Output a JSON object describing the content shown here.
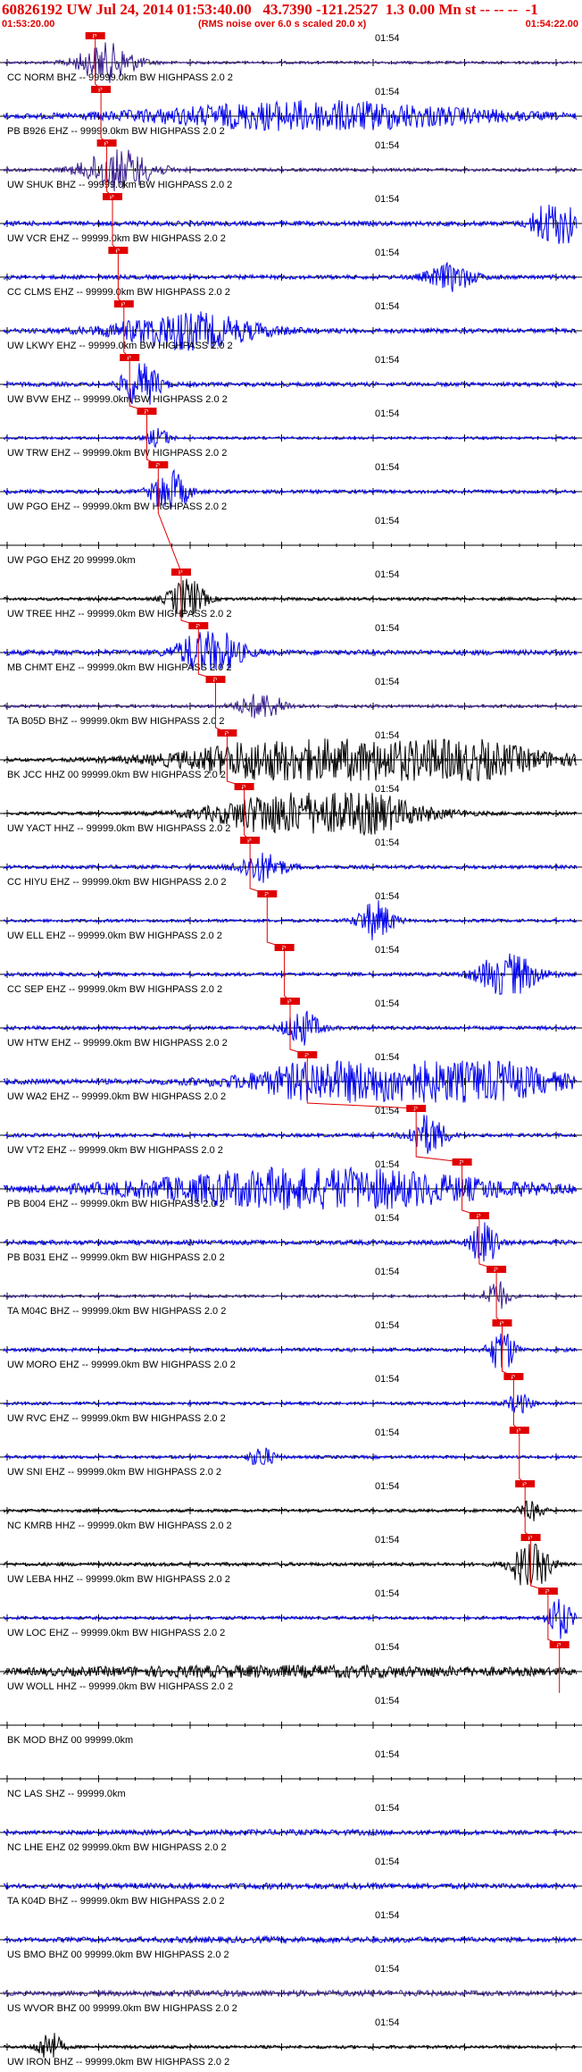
{
  "header": {
    "title": "60826192 UW Jul 24, 2014 01:53:40.00   43.7390 -121.2527  1.3 0.00 Mn st -- -- --  -1",
    "start_time": "01:53:20.00",
    "end_time": "01:54:22.00",
    "note": "(RMS noise over 6.0 s scaled 20.0 x)"
  },
  "time_tick_label": "01:54",
  "pick_label": "P",
  "colors": {
    "title": "#e00000",
    "trace_blue": "#0000ee",
    "trace_black": "#000000",
    "trace_purple": "#3a1f8f",
    "pick": "#e00000"
  },
  "stations": [
    {
      "label": "CC NORM BHZ -- 99999.0km BW  HIGHPASS  2.0  2",
      "color": "#3a1f8f",
      "amp": 0.25,
      "pick": 0.16,
      "burst": {
        "at": 0.18,
        "w": 0.05,
        "a": 1.2
      }
    },
    {
      "label": "PB B926 EHZ -- 99999.0km BW  HIGHPASS  2.0  2",
      "color": "#0000ee",
      "amp": 0.35,
      "pick": 0.17,
      "burst": {
        "at": 0.55,
        "w": 0.3,
        "a": 0.9
      }
    },
    {
      "label": "UW SHUK BHZ -- 99999.0km BW  HIGHPASS  2.0  2",
      "color": "#3a1f8f",
      "amp": 0.3,
      "pick": 0.18,
      "burst": {
        "at": 0.2,
        "w": 0.06,
        "a": 1.3
      }
    },
    {
      "label": "UW VCR EHZ -- 99999.0km BW  HIGHPASS  2.0  2",
      "color": "#0000ee",
      "amp": 0.45,
      "pick": 0.19,
      "burst": {
        "at": 0.96,
        "w": 0.03,
        "a": 2.4
      }
    },
    {
      "label": "CC CLMS EHZ -- 99999.0km BW  HIGHPASS  2.0  2",
      "color": "#0000ee",
      "amp": 0.4,
      "pick": 0.2,
      "burst": {
        "at": 0.78,
        "w": 0.04,
        "a": 0.8
      }
    },
    {
      "label": "UW LKWY EHZ -- 99999.0km BW  HIGHPASS  2.0  2",
      "color": "#0000ee",
      "amp": 0.45,
      "pick": 0.21,
      "burst": {
        "at": 0.32,
        "w": 0.12,
        "a": 1.1
      }
    },
    {
      "label": "UW BVW EHZ -- 99999.0km BW  HIGHPASS  2.0  2",
      "color": "#0000ee",
      "amp": 0.4,
      "pick": 0.22,
      "burst": {
        "at": 0.24,
        "w": 0.03,
        "a": 1.6
      }
    },
    {
      "label": "UW TRW EHZ -- 99999.0km BW  HIGHPASS  2.0  2",
      "color": "#0000ee",
      "amp": 0.25,
      "pick": 0.25,
      "burst": {
        "at": 0.27,
        "w": 0.02,
        "a": 0.6
      }
    },
    {
      "label": "UW PGO EHZ -- 99999.0km BW  HIGHPASS  2.0  2",
      "color": "#0000ee",
      "amp": 0.35,
      "pick": 0.27,
      "burst": {
        "at": 0.29,
        "w": 0.03,
        "a": 1.4
      }
    },
    {
      "label": "UW PGO EHZ 20 99999.0km",
      "color": "#0000ee",
      "amp": 0.0,
      "pick": 0.0,
      "burst": {
        "at": 0.0,
        "w": 0.01,
        "a": 0.0
      }
    },
    {
      "label": "UW TREE HHZ -- 99999.0km BW  HIGHPASS  2.0  2",
      "color": "#000000",
      "amp": 0.3,
      "pick": 0.31,
      "burst": {
        "at": 0.32,
        "w": 0.03,
        "a": 1.3
      }
    },
    {
      "label": "MB CHMT EHZ -- 99999.0km BW  HIGHPASS  2.0  2",
      "color": "#0000ee",
      "amp": 0.5,
      "pick": 0.34,
      "burst": {
        "at": 0.36,
        "w": 0.05,
        "a": 1.6
      }
    },
    {
      "label": "TA B05D BHZ -- 99999.0km BW  HIGHPASS  2.0  2",
      "color": "#3a1f8f",
      "amp": 0.3,
      "pick": 0.37,
      "burst": {
        "at": 0.45,
        "w": 0.04,
        "a": 0.8
      }
    },
    {
      "label": "BK JCC HHZ 00 99999.0km BW  HIGHPASS  2.0  2",
      "color": "#000000",
      "amp": 0.3,
      "pick": 0.39,
      "burst": {
        "at": 0.63,
        "w": 0.25,
        "a": 2.4
      }
    },
    {
      "label": "UW YACT HHZ -- 99999.0km BW  HIGHPASS  2.0  2",
      "color": "#000000",
      "amp": 0.3,
      "pick": 0.42,
      "burst": {
        "at": 0.55,
        "w": 0.15,
        "a": 2.0
      }
    },
    {
      "label": "CC HIYU EHZ -- 99999.0km BW  HIGHPASS  2.0  2",
      "color": "#0000ee",
      "amp": 0.35,
      "pick": 0.43,
      "burst": {
        "at": 0.45,
        "w": 0.04,
        "a": 0.9
      }
    },
    {
      "label": "UW ELL EHZ -- 99999.0km BW  HIGHPASS  2.0  2",
      "color": "#0000ee",
      "amp": 0.3,
      "pick": 0.46,
      "burst": {
        "at": 0.65,
        "w": 0.03,
        "a": 1.2
      }
    },
    {
      "label": "CC SEP EHZ -- 99999.0km BW  HIGHPASS  2.0  2",
      "color": "#0000ee",
      "amp": 0.35,
      "pick": 0.49,
      "burst": {
        "at": 0.88,
        "w": 0.05,
        "a": 1.4
      }
    },
    {
      "label": "UW HTW EHZ -- 99999.0km BW  HIGHPASS  2.0  2",
      "color": "#0000ee",
      "amp": 0.35,
      "pick": 0.5,
      "burst": {
        "at": 0.52,
        "w": 0.03,
        "a": 1.1
      }
    },
    {
      "label": "UW WA2 EHZ -- 99999.0km BW  HIGHPASS  2.0  2",
      "color": "#0000ee",
      "amp": 0.5,
      "pick": 0.53,
      "burst": {
        "at": 0.7,
        "w": 0.2,
        "a": 2.6
      }
    },
    {
      "label": "UW VT2 EHZ -- 99999.0km BW  HIGHPASS  2.0  2",
      "color": "#0000ee",
      "amp": 0.35,
      "pick": 0.72,
      "burst": {
        "at": 0.74,
        "w": 0.03,
        "a": 1.3
      }
    },
    {
      "label": "PB B004 EHZ -- 99999.0km BW  HIGHPASS  2.0  2",
      "color": "#0000ee",
      "amp": 0.5,
      "pick": 0.8,
      "burst": {
        "at": 0.55,
        "w": 0.3,
        "a": 1.3
      }
    },
    {
      "label": "PB B031 EHZ -- 99999.0km BW  HIGHPASS  2.0  2",
      "color": "#0000ee",
      "amp": 0.45,
      "pick": 0.83,
      "burst": {
        "at": 0.84,
        "w": 0.02,
        "a": 2.0
      }
    },
    {
      "label": "TA M04C BHZ -- 99999.0km BW  HIGHPASS  2.0  2",
      "color": "#3a1f8f",
      "amp": 0.25,
      "pick": 0.86,
      "burst": {
        "at": 0.86,
        "w": 0.02,
        "a": 1.0
      }
    },
    {
      "label": "UW MORO EHZ -- 99999.0km BW  HIGHPASS  2.0  2",
      "color": "#0000ee",
      "amp": 0.35,
      "pick": 0.87,
      "burst": {
        "at": 0.87,
        "w": 0.02,
        "a": 1.6
      }
    },
    {
      "label": "UW RVC EHZ -- 99999.0km BW  HIGHPASS  2.0  2",
      "color": "#0000ee",
      "amp": 0.3,
      "pick": 0.89,
      "burst": {
        "at": 0.9,
        "w": 0.02,
        "a": 0.6
      }
    },
    {
      "label": "UW SNI EHZ -- 99999.0km BW  HIGHPASS  2.0  2",
      "color": "#0000ee",
      "amp": 0.3,
      "pick": 0.9,
      "burst": {
        "at": 0.45,
        "w": 0.02,
        "a": 0.7
      }
    },
    {
      "label": "NC KMRB HHZ -- 99999.0km BW  HIGHPASS  2.0  2",
      "color": "#000000",
      "amp": 0.3,
      "pick": 0.91,
      "burst": {
        "at": 0.92,
        "w": 0.02,
        "a": 0.6
      }
    },
    {
      "label": "UW LEBA HHZ -- 99999.0km BW  HIGHPASS  2.0  2",
      "color": "#000000",
      "amp": 0.35,
      "pick": 0.92,
      "burst": {
        "at": 0.92,
        "w": 0.03,
        "a": 2.0
      }
    },
    {
      "label": "UW LOC EHZ -- 99999.0km BW  HIGHPASS  2.0  2",
      "color": "#0000ee",
      "amp": 0.3,
      "pick": 0.95,
      "burst": {
        "at": 0.97,
        "w": 0.02,
        "a": 1.4
      }
    },
    {
      "label": "UW WOLL HHZ -- 99999.0km BW  HIGHPASS  2.0  2",
      "color": "#000000",
      "amp": 0.35,
      "pick": 0.97,
      "burst": {
        "at": 0.5,
        "w": 0.5,
        "a": 0.3
      }
    },
    {
      "label": "BK MOD BHZ 00 99999.0km",
      "color": "#0000ee",
      "amp": 0.0,
      "pick": 0.0,
      "burst": {
        "at": 0.0,
        "w": 0.01,
        "a": 0.0
      }
    },
    {
      "label": "NC LAS SHZ -- 99999.0km",
      "color": "#0000ee",
      "amp": 0.0,
      "pick": 0.0,
      "burst": {
        "at": 0.0,
        "w": 0.01,
        "a": 0.0
      }
    },
    {
      "label": "NC LHE EHZ 02 99999.0km BW  HIGHPASS  2.0  2",
      "color": "#0000ee",
      "amp": 0.25,
      "pick": 0.0,
      "burst": {
        "at": 0.5,
        "w": 0.5,
        "a": 0.1
      }
    },
    {
      "label": "TA K04D BHZ -- 99999.0km BW  HIGHPASS  2.0  2",
      "color": "#0000ee",
      "amp": 0.3,
      "pick": 0.0,
      "burst": {
        "at": 0.5,
        "w": 0.5,
        "a": 0.1
      }
    },
    {
      "label": "US BMO BHZ 00 99999.0km BW  HIGHPASS  2.0  2",
      "color": "#0000ee",
      "amp": 0.3,
      "pick": 0.0,
      "burst": {
        "at": 0.5,
        "w": 0.5,
        "a": 0.1
      }
    },
    {
      "label": "US WVOR BHZ 00 99999.0km BW  HIGHPASS  2.0  2",
      "color": "#3a1f8f",
      "amp": 0.3,
      "pick": 0.0,
      "burst": {
        "at": 0.5,
        "w": 0.5,
        "a": 0.1
      }
    },
    {
      "label": "UW IRON BHZ -- 99999.0km BW  HIGHPASS  2.0  2",
      "color": "#000000",
      "amp": 0.3,
      "pick": 0.0,
      "burst": {
        "at": 0.08,
        "w": 0.02,
        "a": 1.0
      }
    }
  ]
}
